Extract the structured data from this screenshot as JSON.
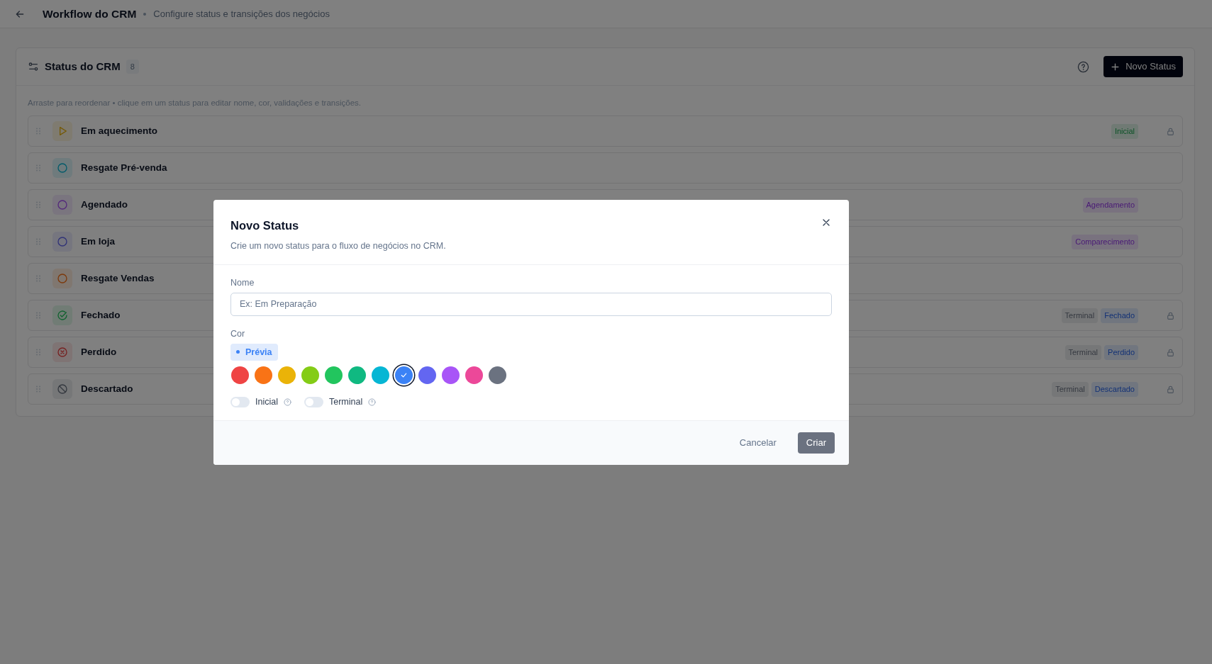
{
  "header": {
    "title": "Workflow do CRM",
    "subtitle": "Configure status e transições dos negócios"
  },
  "panel": {
    "title": "Status do CRM",
    "count": "8",
    "new_button": "Novo Status",
    "hint": "Arraste para reordenar • clique em um status para editar nome, cor, validações e transições."
  },
  "statuses": [
    {
      "name": "Em aquecimento",
      "kind": "play",
      "color": "#755904",
      "locked": true,
      "tags": [
        {
          "label": "Inicial",
          "color": "#0b5125"
        }
      ]
    },
    {
      "name": "Resgate Pré-venda",
      "kind": "circle",
      "color": "#035b6a",
      "locked": false
    },
    {
      "name": "Agendado",
      "kind": "circle",
      "color": "#542a7b",
      "locked": false,
      "tags": [
        {
          "label": "Agendamento",
          "color": "#491975"
        }
      ]
    },
    {
      "name": "Em loja",
      "kind": "circle",
      "color": "#313378",
      "locked": false,
      "tags": [
        {
          "label": "Comparecimento",
          "color": "#491975"
        }
      ]
    },
    {
      "name": "Resgate Vendas",
      "kind": "circle",
      "color": "#7c390b",
      "locked": false
    },
    {
      "name": "Fechado",
      "kind": "check",
      "color": "#11622f",
      "locked": true,
      "tags": [
        {
          "label": "Terminal",
          "color": "#353940"
        },
        {
          "label": "Fechado",
          "color": "#123175"
        }
      ]
    },
    {
      "name": "Perdido",
      "kind": "x",
      "color": "#772222",
      "locked": true,
      "tags": [
        {
          "label": "Terminal",
          "color": "#353940"
        },
        {
          "label": "Perdido",
          "color": "#123175"
        }
      ]
    },
    {
      "name": "Descartado",
      "kind": "ban",
      "color": "#353940",
      "locked": true,
      "tags": [
        {
          "label": "Terminal",
          "color": "#353940"
        },
        {
          "label": "Descartado",
          "color": "#123175"
        }
      ]
    }
  ],
  "dialog": {
    "title": "Novo Status",
    "description": "Crie um novo status para o fluxo de negócios no CRM.",
    "name_label": "Nome",
    "name_placeholder": "Ex: Em Preparação",
    "color_label": "Cor",
    "preview": "Prévia",
    "swatches": [
      {
        "color": "#ef4444",
        "selected": false
      },
      {
        "color": "#f97316",
        "selected": false
      },
      {
        "color": "#eab308",
        "selected": false
      },
      {
        "color": "#84cc16",
        "selected": false
      },
      {
        "color": "#22c55e",
        "selected": false
      },
      {
        "color": "#10b981",
        "selected": false
      },
      {
        "color": "#06b6d4",
        "selected": false
      },
      {
        "color": "#3b82f6",
        "selected": true
      },
      {
        "color": "#6366f1",
        "selected": false
      },
      {
        "color": "#a855f7",
        "selected": false
      },
      {
        "color": "#ec4899",
        "selected": false
      },
      {
        "color": "#6b7280",
        "selected": false
      }
    ],
    "toggles": [
      {
        "label": "Inicial",
        "on": false
      },
      {
        "label": "Terminal",
        "on": false
      }
    ],
    "cancel": "Cancelar",
    "create": {
      "label": "Criar",
      "disabled": true
    }
  }
}
